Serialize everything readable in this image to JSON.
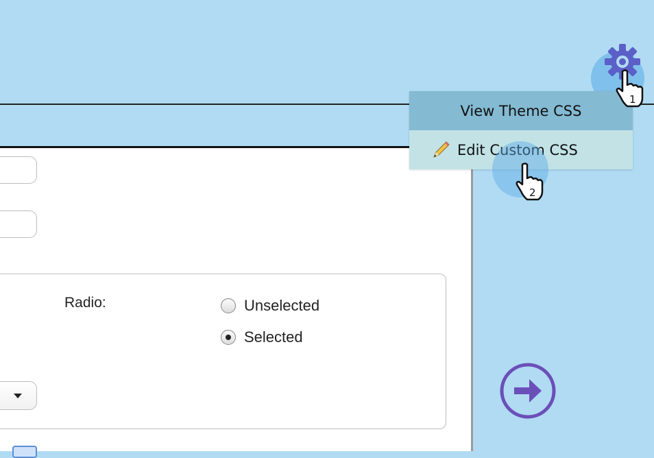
{
  "menu": {
    "view_theme_css": "View Theme CSS",
    "edit_custom_css": "Edit Custom CSS"
  },
  "form": {
    "radio_label": "Radio:",
    "radio_options": [
      {
        "label": "Unselected",
        "selected": false
      },
      {
        "label": "Selected",
        "selected": true
      }
    ]
  },
  "step_markers": {
    "step1": "1",
    "step2": "2"
  },
  "icons": {
    "gear": "gear-icon",
    "pencil": "pencil-icon",
    "next_arrow": "arrow-right-circle-icon",
    "cursor": "hand-pointer-icon"
  },
  "colors": {
    "background": "#b0dbf3",
    "menu_view_bg": "#84bad2",
    "menu_edit_bg": "#c2e2e6",
    "gear": "#5b5fc7",
    "arrow": "#6b4fb8"
  }
}
